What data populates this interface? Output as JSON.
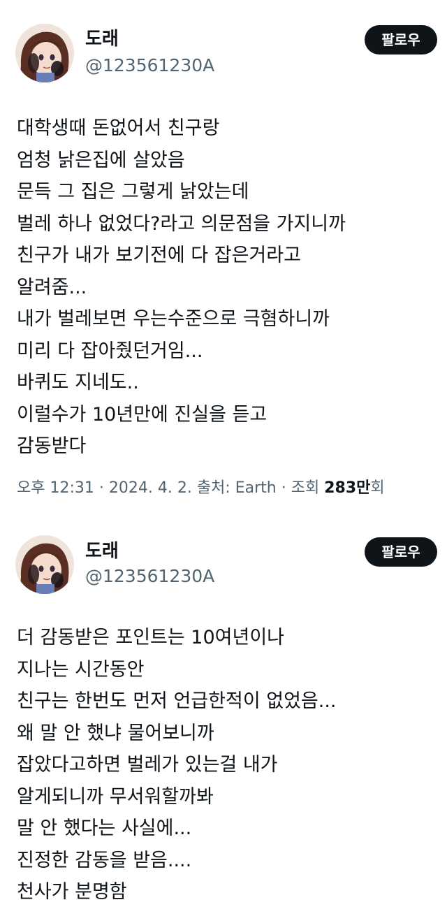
{
  "tweets": [
    {
      "author": {
        "display_name": "도래",
        "handle": "@123561230A",
        "avatar_icon": "anime-character-avatar"
      },
      "follow_label": "팔로우",
      "lines": [
        "대학생때 돈없어서 친구랑",
        "엄청 낡은집에 살았음",
        "문득 그 집은 그렇게 낡았는데",
        "벌레 하나 없었다?라고 의문점을 가지니까",
        "친구가 내가 보기전에 다 잡은거라고",
        "알려줌...",
        "내가 벌레보면 우는수준으로 극혐하니까",
        "미리 다 잡아줬던거임...",
        "바퀴도 지네도..",
        "이럴수가 10년만에 진실을 듣고",
        "감동받다"
      ],
      "meta": {
        "time": "오후 12:31",
        "date": "2024. 4. 2.",
        "source_label": "출처:",
        "source": "Earth",
        "views_label": "조회",
        "views_number": "283",
        "views_unit": "만",
        "views_suffix": "회",
        "separator": "·"
      }
    },
    {
      "author": {
        "display_name": "도래",
        "handle": "@123561230A",
        "avatar_icon": "anime-character-avatar"
      },
      "follow_label": "팔로우",
      "lines": [
        "더 감동받은 포인트는 10여년이나",
        "지나는 시간동안",
        "친구는 한번도 먼저 언급한적이 없었음...",
        "왜 말 안 했냐 물어보니까",
        "잡았다고하면 벌레가 있는걸 내가",
        "알게되니까 무서워할까봐",
        "말 안 했다는 사실에...",
        "진정한 감동을 받음....",
        "천사가 분명함"
      ]
    }
  ],
  "colors": {
    "text": "#0f1419",
    "secondary": "#536471",
    "button_bg": "#0f1419",
    "button_text": "#ffffff",
    "background": "#ffffff"
  }
}
